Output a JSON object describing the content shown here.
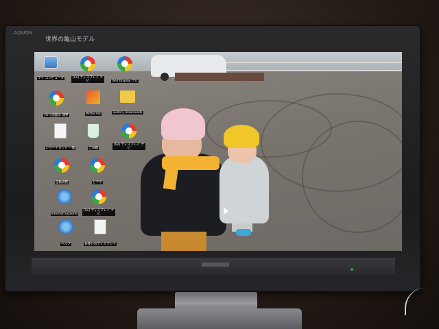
{
  "tv": {
    "brand": "AQUOS",
    "caption": "世界の亀山モデル"
  },
  "desktop": {
    "icons": [
      {
        "label": "マイ コンピュータ",
        "icon": "computer-icon"
      },
      {
        "label": "[Sn] ディスプレイ ナビ",
        "icon": "media-icon"
      },
      {
        "label": "[Sn] Display ナビ",
        "icon": "media-icon"
      },
      {
        "label": "[Sn] 画面の 調整",
        "icon": "media-icon"
      },
      {
        "label": "Writer.lnk",
        "icon": "write-icon"
      },
      {
        "label": "Gallery Downloads",
        "icon": "folder-icon"
      },
      {
        "label": "ショートカット 一覧",
        "icon": "document-icon"
      },
      {
        "label": "ごみ箱",
        "icon": "recycle-bin-icon"
      },
      {
        "label": "[Sn] ディスプレイ ナビ",
        "icon": "media-icon"
      },
      {
        "label": "自動調整",
        "icon": "media-icon"
      },
      {
        "label": "ビデオ",
        "icon": "media-icon"
      },
      {
        "label": "Internet Explorer",
        "icon": "internet-explorer-icon"
      },
      {
        "label": "[Sn] ディスプレイ ナビ",
        "icon": "media-icon"
      },
      {
        "label": "ヘルプ",
        "icon": "internet-explorer-icon"
      },
      {
        "label": "お使いのディスプレイ",
        "icon": "spreadsheet-icon"
      }
    ]
  }
}
